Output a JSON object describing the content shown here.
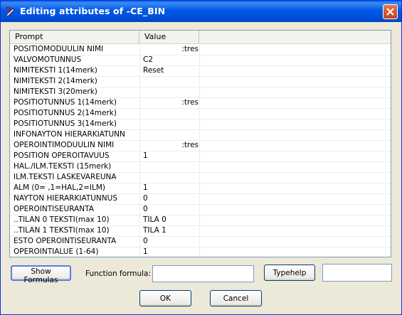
{
  "window": {
    "title": "Editing attributes of -CE_BIN"
  },
  "table": {
    "columns": [
      "Prompt",
      "Value"
    ],
    "rows": [
      {
        "prompt": "POSITIOMODUULIN NIMI",
        "value": ":tres"
      },
      {
        "prompt": "VALVOMOTUNNUS",
        "value": "C2"
      },
      {
        "prompt": "NIMITEKSTI 1(14merk)",
        "value": "Reset"
      },
      {
        "prompt": "NIMITEKSTI 2(14merk)",
        "value": ""
      },
      {
        "prompt": "NIMITEKSTI 3(20merk)",
        "value": ""
      },
      {
        "prompt": "POSITIOTUNNUS 1(14merk)",
        "value": ":tres"
      },
      {
        "prompt": "POSITIOTUNNUS 2(14merk)",
        "value": ""
      },
      {
        "prompt": "POSITIOTUNNUS 3(14merk)",
        "value": ""
      },
      {
        "prompt": "INFONAYTON HIERARKIATUNN",
        "value": ""
      },
      {
        "prompt": "OPEROINTIMODUULIN NIMI",
        "value": ":tres"
      },
      {
        "prompt": "POSITION OPEROITAVUUS",
        "value": "1"
      },
      {
        "prompt": "HAL./ILM.TEKSTI (15merk)",
        "value": ""
      },
      {
        "prompt": "ILM.TEKSTI LASKEVAREUNA",
        "value": ""
      },
      {
        "prompt": "ALM (0= ,1=HAL,2=ILM)",
        "value": "1"
      },
      {
        "prompt": "NAYTON HIERARKIATUNNUS",
        "value": "0"
      },
      {
        "prompt": "OPEROINTISEURANTA",
        "value": "0"
      },
      {
        "prompt": "..TILAN 0 TEKSTI(max 10)",
        "value": "TILA 0"
      },
      {
        "prompt": "..TILAN 1 TEKSTI(max 10)",
        "value": "TILA 1"
      },
      {
        "prompt": "ESTO OPEROINTISEURANTA",
        "value": "0"
      },
      {
        "prompt": "OPEROINTIALUE (1-64)",
        "value": "1"
      }
    ]
  },
  "controls": {
    "show_formulas": "Show Formulas",
    "function_formula_label": "Function formula:",
    "function_formula_value": "",
    "typehelp": "Typehelp",
    "typehelp_value": "",
    "ok": "OK",
    "cancel": "Cancel"
  }
}
